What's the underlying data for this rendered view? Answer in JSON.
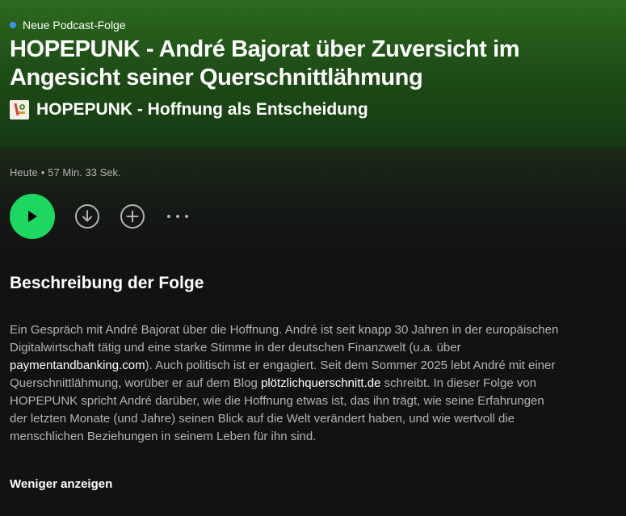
{
  "episode": {
    "eyebrow": "Neue Podcast-Folge",
    "title": "HOPEPUNK - André Bajorat über Zuversicht im Angesicht seiner Querschnittlähmung",
    "show_title": "HOPEPUNK - Hoffnung als Entscheidung",
    "date": "Heute",
    "separator": "•",
    "duration": "57 Min. 33 Sek."
  },
  "colors": {
    "accent": "#1ed760",
    "eyebrow_dot": "#3d91f4",
    "hero_green": "#2d6a1f",
    "background": "#121212"
  },
  "icons": {
    "play": "play-icon",
    "download": "download-icon",
    "add": "add-icon",
    "more": "more-options-icon"
  },
  "description": {
    "heading": "Beschreibung der Folge",
    "part1": "Ein Gespräch mit André Bajorat über die Hoffnung. André ist seit knapp 30 Jahren in der europäischen Digitalwirtschaft tätig und eine starke Stimme in der deutschen Finanzwelt (u.a. über ",
    "link1": "paymentandbanking.com",
    "part2": "). Auch politisch ist er engagiert. Seit dem Sommer 2025 lebt André mit einer Querschnittlähmung, worüber er auf dem Blog ",
    "link2": "plötzlichquerschnitt.de",
    "part3": " schreibt. In dieser Folge von HOPEPUNK spricht André darüber, wie die Hoffnung etwas ist, das ihn trägt, wie seine Erfahrungen der letzten Monate (und Jahre) seinen Blick auf die Welt verändert haben, und wie wertvoll die menschlichen Beziehungen in seinem Leben für ihn sind.",
    "show_less": "Weniger anzeigen"
  }
}
